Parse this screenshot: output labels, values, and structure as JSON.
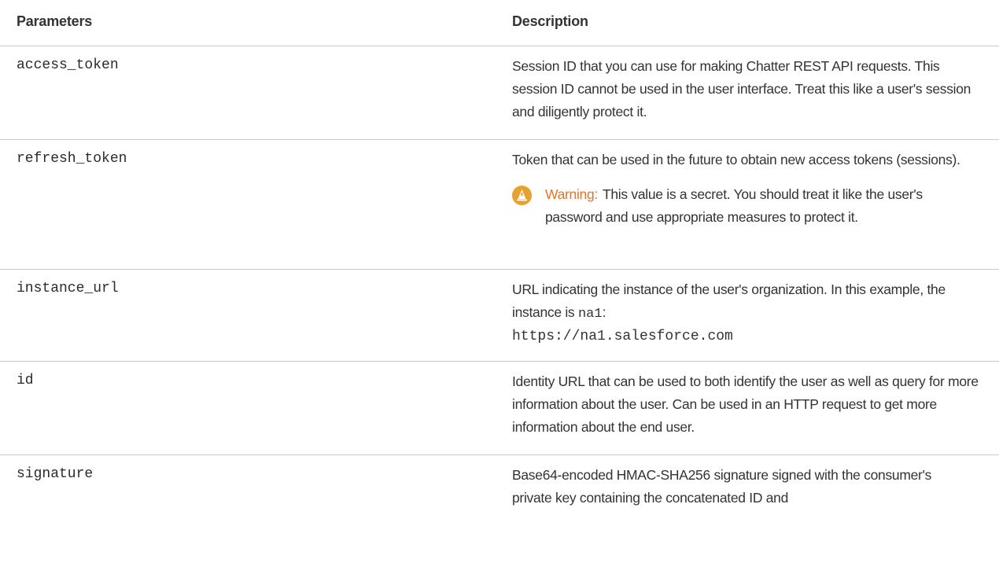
{
  "table": {
    "headers": {
      "parameters": "Parameters",
      "description": "Description"
    },
    "rows": [
      {
        "param": "access_token",
        "description": "Session ID that you can use for making Chatter REST API requests. This session ID cannot be used in the user interface. Treat this like a user's session and diligently protect it."
      },
      {
        "param": "refresh_token",
        "description": "Token that can be used in the future to obtain new access tokens (sessions).",
        "warning_label": "Warning:",
        "warning_text": "This value is a secret. You should treat it like the user's password and use appropriate measures to protect it.",
        "warning_icon": "warning-icon"
      },
      {
        "param": "instance_url",
        "description_prefix": "URL indicating the instance of the user's organization. In this example, the instance is",
        "description_code": "na1",
        "description_colon": ":",
        "description_url": "https://na1.salesforce.com"
      },
      {
        "param": "id",
        "description": "Identity URL that can be used to both identify the user as well as query for more information about the user. Can be used in an HTTP request to get more information about the end user."
      },
      {
        "param": "signature",
        "description": "Base64-encoded HMAC-SHA256 signature signed with the consumer's private key containing the concatenated ID and"
      }
    ]
  },
  "colors": {
    "text": "#333333",
    "border": "#c9c9c9",
    "warning_icon": "#e6a231",
    "warning_label": "#e0752f"
  }
}
